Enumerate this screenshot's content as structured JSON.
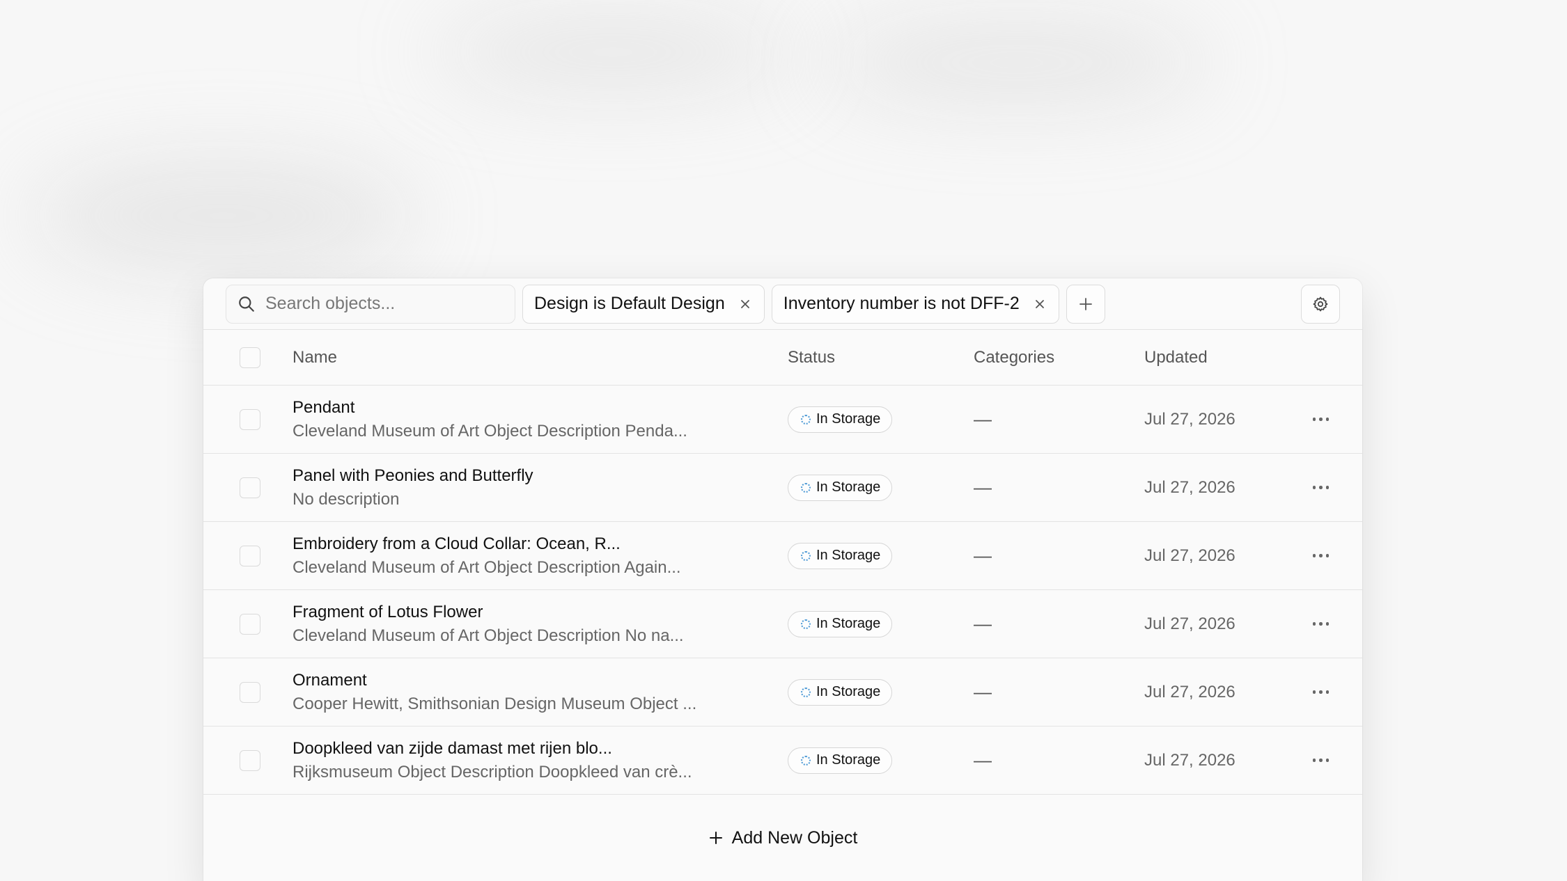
{
  "search": {
    "placeholder": "Search objects..."
  },
  "filters": [
    {
      "label": "Design is Default Design"
    },
    {
      "label": "Inventory number is not DFF-2"
    }
  ],
  "columns": {
    "name": "Name",
    "status": "Status",
    "categories": "Categories",
    "updated": "Updated"
  },
  "rows": [
    {
      "name": "Pendant",
      "description": "Cleveland Museum of Art Object Description Penda...",
      "status": "In Storage",
      "categories": "—",
      "updated": "Jul 27, 2026"
    },
    {
      "name": "Panel with Peonies and Butterfly",
      "description": "No description",
      "status": "In Storage",
      "categories": "—",
      "updated": "Jul 27, 2026"
    },
    {
      "name": "Embroidery from a Cloud Collar: Ocean, R...",
      "description": "Cleveland Museum of Art Object Description Again...",
      "status": "In Storage",
      "categories": "—",
      "updated": "Jul 27, 2026"
    },
    {
      "name": "Fragment of Lotus Flower",
      "description": "Cleveland Museum of Art Object Description No na...",
      "status": "In Storage",
      "categories": "—",
      "updated": "Jul 27, 2026"
    },
    {
      "name": "Ornament",
      "description": "Cooper Hewitt, Smithsonian Design Museum Object ...",
      "status": "In Storage",
      "categories": "—",
      "updated": "Jul 27, 2026"
    },
    {
      "name": "Doopkleed van zijde damast met rijen blo...",
      "description": "Rijksmuseum Object Description Doopkleed van crè...",
      "status": "In Storage",
      "categories": "—",
      "updated": "Jul 27, 2026"
    }
  ],
  "footer": {
    "add_label": "Add New Object"
  },
  "colors": {
    "status_dot": "#4f9bd6",
    "border": "#e3e3e3",
    "panel_bg": "#fafafa"
  }
}
